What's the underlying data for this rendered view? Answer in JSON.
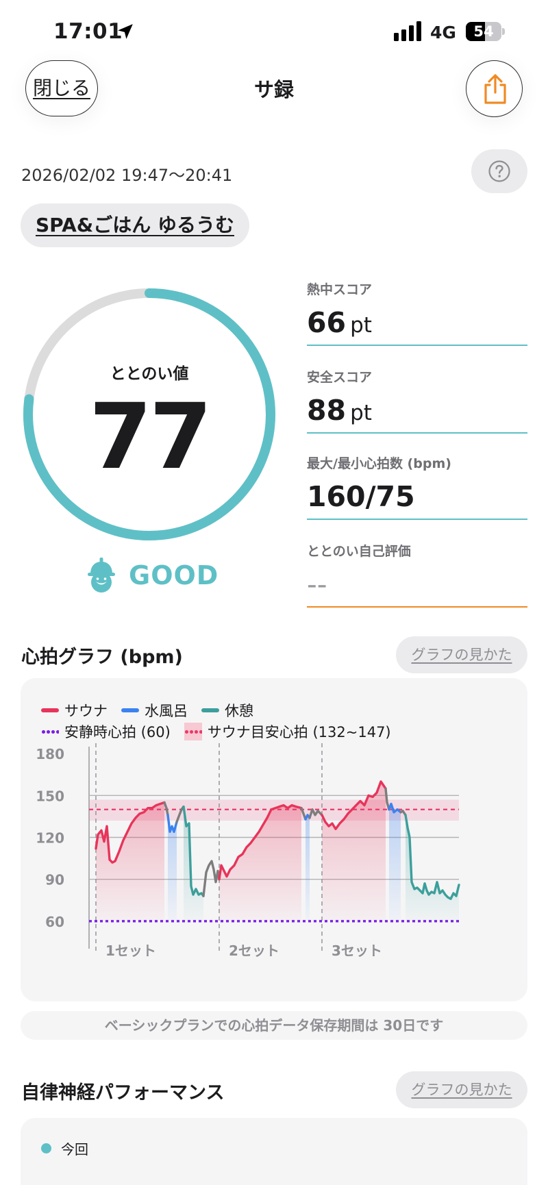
{
  "status_bar": {
    "time": "17:01",
    "network": "4G",
    "battery": "54",
    "battery_level": 0.54
  },
  "header": {
    "close_label": "閉じる",
    "title": "サ録"
  },
  "session": {
    "date_range": "2026/02/02 19:47～20:41",
    "facility": "SPA&ごはん ゆるうむ"
  },
  "score": {
    "label": "ととのい値",
    "value": "77",
    "progress": 0.77,
    "mood": "GOOD",
    "ring_color": "#5ec0c6",
    "track_color": "#dcdcdc"
  },
  "stats": [
    {
      "label": "熱中スコア",
      "value": "66",
      "unit": "pt"
    },
    {
      "label": "安全スコア",
      "value": "88",
      "unit": "pt"
    },
    {
      "label": "最大/最小心拍数 (bpm)",
      "value": "160/75",
      "unit": ""
    },
    {
      "label": "ととのい自己評価",
      "value": "--",
      "unit": ""
    }
  ],
  "heart_graph": {
    "title": "心拍グラフ (bpm)",
    "guide_label": "グラフの見かた",
    "legend": {
      "sauna": "サウナ",
      "cold_bath": "水風呂",
      "rest": "休憩",
      "resting_hr": "安静時心拍 (60)",
      "sauna_target": "サウナ目安心拍 (132~147)"
    },
    "colors": {
      "sauna": "#e8345a",
      "cold_bath": "#3b82f0",
      "rest": "#3c9f9b",
      "transition": "#7d7d7d",
      "resting": "#7b1fe8",
      "target": "#ea3a6b"
    },
    "notice": "ベーシックプランでの心拍データ保存期間は 30日です"
  },
  "chart_data": {
    "type": "line",
    "title": "心拍グラフ (bpm)",
    "xlabel": "",
    "ylabel": "",
    "ylim": [
      55,
      185
    ],
    "y_ticks": [
      60,
      90,
      120,
      150,
      180
    ],
    "x_range": [
      0,
      54
    ],
    "set_labels": [
      "1セット",
      "2セット",
      "3セット"
    ],
    "set_starts": [
      1,
      19,
      34
    ],
    "resting_hr": 60,
    "target_band": [
      132,
      147
    ],
    "target_line": 140,
    "grid": true,
    "phases": [
      {
        "phase": "sauna",
        "start": 1,
        "end": 11
      },
      {
        "phase": "cold_bath",
        "start": 11.5,
        "end": 12.8
      },
      {
        "phase": "rest",
        "start": 13.5,
        "end": 16.7
      },
      {
        "phase": "sauna",
        "start": 19,
        "end": 31
      },
      {
        "phase": "cold_bath",
        "start": 31.6,
        "end": 32.2
      },
      {
        "phase": "sauna",
        "start": 34,
        "end": 43.3
      },
      {
        "phase": "cold_bath",
        "start": 43.8,
        "end": 45.5
      },
      {
        "phase": "rest",
        "start": 46.2,
        "end": 54
      }
    ],
    "series": [
      {
        "name": "サウナ",
        "phase": "sauna",
        "points": [
          [
            1,
            112
          ],
          [
            1.3,
            122
          ],
          [
            1.8,
            125
          ],
          [
            2.2,
            117
          ],
          [
            2.6,
            128
          ],
          [
            3,
            104
          ],
          [
            3.4,
            102
          ],
          [
            3.8,
            103
          ],
          [
            4.4,
            110
          ],
          [
            5,
            118
          ],
          [
            5.6,
            124
          ],
          [
            6.2,
            130
          ],
          [
            6.8,
            134
          ],
          [
            7.4,
            137
          ],
          [
            8,
            138
          ],
          [
            8.6,
            141
          ],
          [
            9.2,
            141
          ],
          [
            9.8,
            143
          ],
          [
            10.4,
            144
          ],
          [
            11,
            145
          ]
        ]
      },
      {
        "name": "",
        "phase": "transition",
        "points": [
          [
            11,
            145
          ],
          [
            11.3,
            141
          ],
          [
            11.5,
            136
          ]
        ]
      },
      {
        "name": "水風呂",
        "phase": "cold_bath",
        "points": [
          [
            11.5,
            136
          ],
          [
            11.8,
            124
          ],
          [
            12.1,
            128
          ],
          [
            12.4,
            124
          ],
          [
            12.8,
            131
          ]
        ]
      },
      {
        "name": "",
        "phase": "transition",
        "points": [
          [
            12.8,
            131
          ],
          [
            13.1,
            135
          ],
          [
            13.5,
            140
          ],
          [
            13.8,
            142
          ]
        ]
      },
      {
        "name": "休憩",
        "phase": "rest",
        "points": [
          [
            13.8,
            142
          ],
          [
            14.2,
            128
          ],
          [
            14.6,
            130
          ],
          [
            14.9,
            85
          ],
          [
            15.2,
            79
          ],
          [
            15.6,
            83
          ],
          [
            16,
            79
          ],
          [
            16.4,
            80
          ],
          [
            16.7,
            78
          ]
        ]
      },
      {
        "name": "",
        "phase": "transition",
        "points": [
          [
            16.7,
            78
          ],
          [
            17.1,
            95
          ],
          [
            17.5,
            100
          ],
          [
            17.9,
            103
          ],
          [
            18.2,
            97
          ],
          [
            18.5,
            88
          ],
          [
            18.8,
            96
          ],
          [
            19,
            90
          ]
        ]
      },
      {
        "name": "サウナ",
        "phase": "sauna",
        "points": [
          [
            19,
            90
          ],
          [
            19.3,
            100
          ],
          [
            19.7,
            96
          ],
          [
            20.1,
            92
          ],
          [
            20.6,
            97
          ],
          [
            21.2,
            100
          ],
          [
            21.8,
            106
          ],
          [
            22.4,
            108
          ],
          [
            23,
            113
          ],
          [
            23.6,
            116
          ],
          [
            24.2,
            120
          ],
          [
            24.8,
            124
          ],
          [
            25.4,
            129
          ],
          [
            26,
            134
          ],
          [
            26.6,
            140
          ],
          [
            27.2,
            141
          ],
          [
            27.8,
            142
          ],
          [
            28.4,
            143
          ],
          [
            29,
            141
          ],
          [
            29.6,
            143
          ],
          [
            30.2,
            142
          ],
          [
            31,
            141
          ]
        ]
      },
      {
        "name": "",
        "phase": "transition",
        "points": [
          [
            31,
            141
          ],
          [
            31.3,
            137
          ],
          [
            31.6,
            133
          ]
        ]
      },
      {
        "name": "水風呂",
        "phase": "cold_bath",
        "points": [
          [
            31.6,
            133
          ],
          [
            31.9,
            136
          ],
          [
            32.2,
            134
          ]
        ]
      },
      {
        "name": "",
        "phase": "transition",
        "points": [
          [
            32.2,
            134
          ],
          [
            32.6,
            140
          ],
          [
            33,
            136
          ],
          [
            33.4,
            139
          ],
          [
            33.8,
            137
          ],
          [
            34,
            136
          ]
        ]
      },
      {
        "name": "サウナ",
        "phase": "sauna",
        "points": [
          [
            34,
            136
          ],
          [
            34.5,
            131
          ],
          [
            35,
            128
          ],
          [
            35.5,
            130
          ],
          [
            36,
            126
          ],
          [
            36.6,
            130
          ],
          [
            37.2,
            133
          ],
          [
            37.8,
            137
          ],
          [
            38.4,
            140
          ],
          [
            39,
            143
          ],
          [
            39.6,
            146
          ],
          [
            40.2,
            143
          ],
          [
            40.8,
            150
          ],
          [
            41.4,
            149
          ],
          [
            42,
            152
          ],
          [
            42.6,
            160
          ],
          [
            43.3,
            155
          ]
        ]
      },
      {
        "name": "",
        "phase": "transition",
        "points": [
          [
            43.3,
            155
          ],
          [
            43.5,
            145
          ],
          [
            43.8,
            140
          ]
        ]
      },
      {
        "name": "水風呂",
        "phase": "cold_bath",
        "points": [
          [
            43.8,
            140
          ],
          [
            44.1,
            144
          ],
          [
            44.5,
            138
          ],
          [
            45,
            140
          ],
          [
            45.5,
            138
          ]
        ]
      },
      {
        "name": "",
        "phase": "transition",
        "points": [
          [
            45.5,
            138
          ],
          [
            45.8,
            139
          ],
          [
            46.2,
            136
          ]
        ]
      },
      {
        "name": "休憩",
        "phase": "rest",
        "points": [
          [
            46.2,
            136
          ],
          [
            46.5,
            127
          ],
          [
            46.8,
            120
          ],
          [
            47.1,
            88
          ],
          [
            47.5,
            83
          ],
          [
            47.9,
            84
          ],
          [
            48.3,
            82
          ],
          [
            48.7,
            80
          ],
          [
            49,
            87
          ],
          [
            49.3,
            82
          ],
          [
            49.6,
            79
          ],
          [
            50,
            81
          ],
          [
            50.4,
            80
          ],
          [
            50.8,
            88
          ],
          [
            51.2,
            80
          ],
          [
            51.6,
            82
          ],
          [
            52,
            79
          ],
          [
            52.4,
            77
          ],
          [
            52.8,
            76
          ],
          [
            53.2,
            80
          ],
          [
            53.6,
            78
          ],
          [
            54,
            86
          ]
        ]
      }
    ]
  },
  "performance": {
    "title": "自律神経パフォーマンス",
    "guide_label": "グラフの見かた",
    "legend_current": "今回"
  }
}
